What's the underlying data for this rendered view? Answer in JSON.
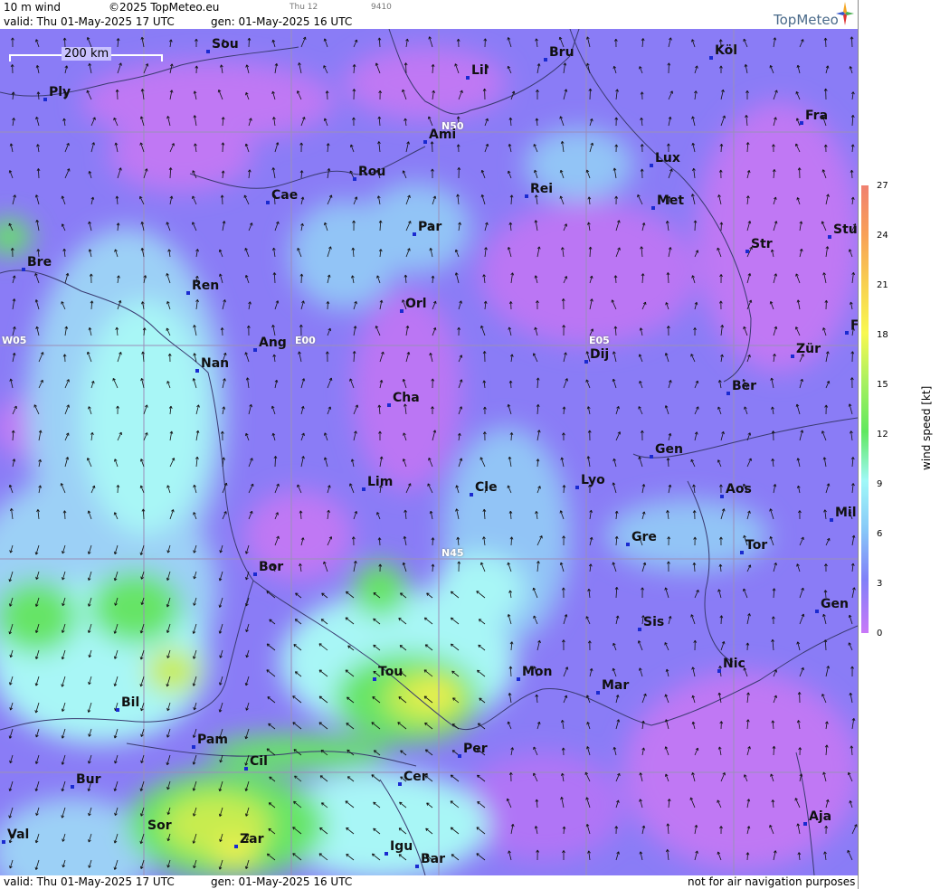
{
  "header": {
    "product": "10 m wind",
    "copyright": "©2025 TopMeteo.eu",
    "tab_small": "Thu 12",
    "code_small": "9410",
    "valid": "valid:  Thu  01-May-2025  17 UTC",
    "gen": "gen:  01-May-2025 16 UTC",
    "logo": "TopMeteo"
  },
  "footer": {
    "valid": "valid:  Thu  01-May-2025  17 UTC",
    "gen": "gen:  01-May-2025 16 UTC",
    "disclaimer": "not for air navigation purposes"
  },
  "scale_label": "200 km",
  "coords": [
    "N50",
    "E00",
    "E05",
    "W05",
    "N45"
  ],
  "cities": [
    "Sou",
    "Ply",
    "Lil",
    "Bru",
    "Köl",
    "Ami",
    "Fra",
    "Lux",
    "Rou",
    "Rei",
    "Cae",
    "Met",
    "Par",
    "Bre",
    "Str",
    "Stu",
    "Ren",
    "Orl",
    "Ang",
    "Dij",
    "Zür",
    "Nan",
    "Ber",
    "Cha",
    "Gen",
    "Lim",
    "Cle",
    "Lyo",
    "Aos",
    "Mil",
    "Gre",
    "Tor",
    "Bor",
    "Sis",
    "Gen",
    "Tou",
    "Mon",
    "Nic",
    "Mar",
    "Bil",
    "Pam",
    "Per",
    "Cil",
    "Bur",
    "Cer",
    "Sor",
    "Aja",
    "Val",
    "Zar",
    "Igu",
    "Bar",
    "F"
  ],
  "legend": {
    "title": "wind  speed  [kt]",
    "ticks": [
      "27",
      "24",
      "21",
      "18",
      "15",
      "12",
      "9",
      "6",
      "3",
      "0"
    ],
    "colors": [
      "#f08070",
      "#f8a058",
      "#f8d050",
      "#f8f850",
      "#a8f060",
      "#60e860",
      "#a0f8f8",
      "#88c8f8",
      "#8080f8",
      "#c878f8"
    ]
  }
}
